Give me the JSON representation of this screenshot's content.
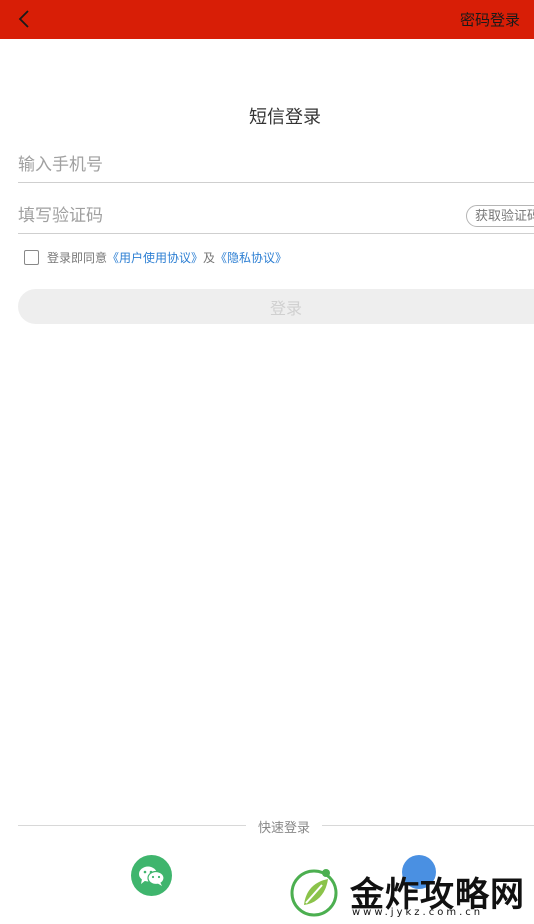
{
  "header": {
    "password_login": "密码登录"
  },
  "page": {
    "title": "短信登录"
  },
  "form": {
    "phone_placeholder": "输入手机号",
    "code_placeholder": "填写验证码",
    "get_code": "获取验证码",
    "agree_prefix": "登录即同意",
    "user_agreement": "《用户使用协议》",
    "and": "及",
    "privacy_policy": "《隐私协议》",
    "login_button": "登录"
  },
  "quick_login": {
    "label": "快速登录"
  },
  "watermark": {
    "brand": "金炸攻略网",
    "url": "www.jykz.com.cn"
  },
  "colors": {
    "header": "#d81e06",
    "link": "#2d7fd3",
    "wechat": "#3fb56d"
  },
  "icons": [
    "back-icon",
    "checkbox-icon",
    "wechat-icon"
  ]
}
